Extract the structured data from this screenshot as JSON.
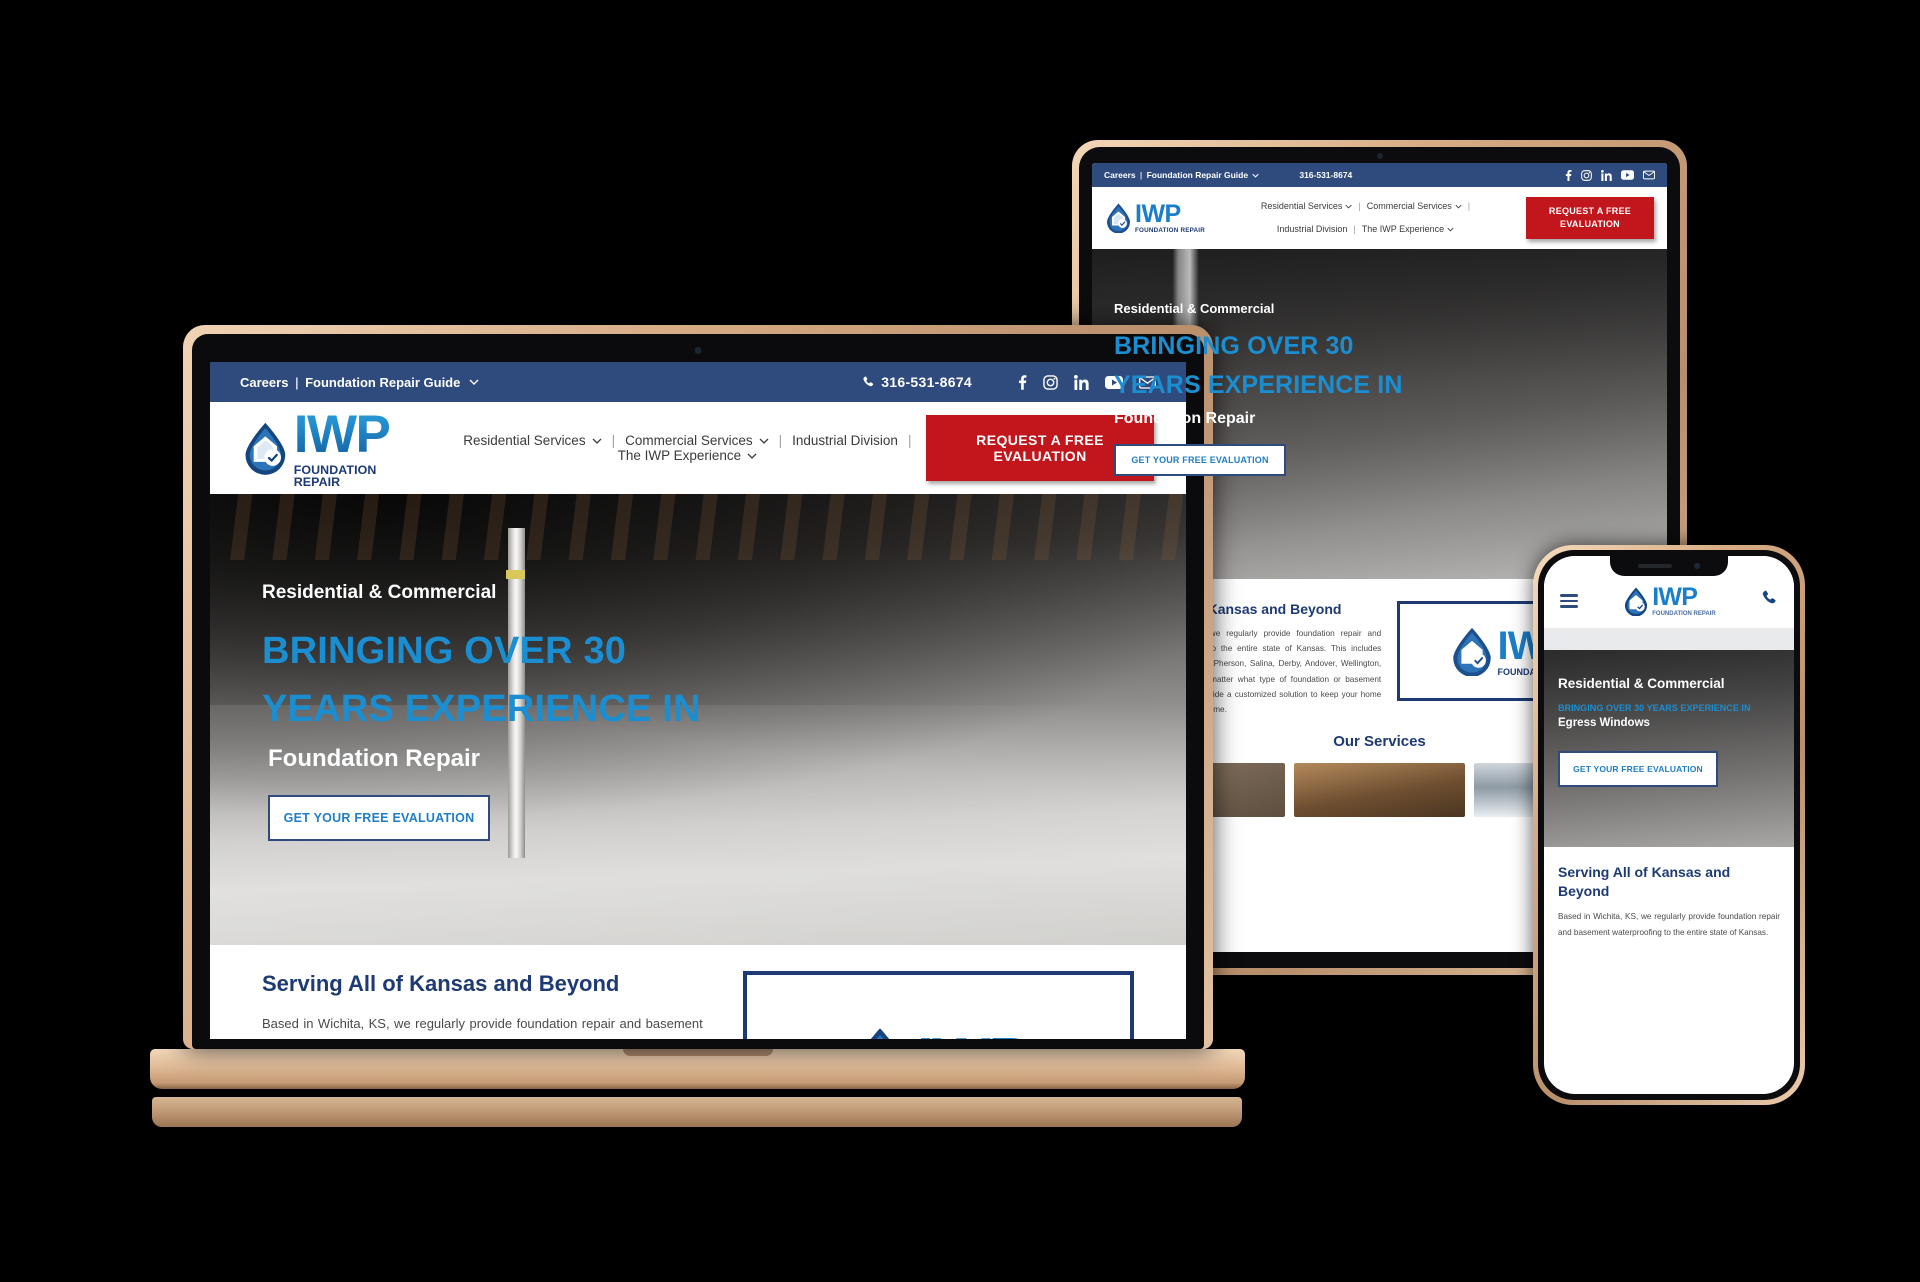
{
  "brand": {
    "name": "IWP",
    "tagline": "FOUNDATION REPAIR",
    "accent_blue": "#1b8ed1",
    "navy": "#1d3a73",
    "topbar_blue": "#2f4a7c",
    "cta_red": "#c1161c"
  },
  "topbar": {
    "careers_label": "Careers",
    "separator": "|",
    "guide_label": "Foundation Repair Guide",
    "guide_caret": "chevron-down-icon",
    "phone": "316-531-8674",
    "phone_icon": "phone-icon",
    "social": [
      {
        "name": "facebook-icon",
        "label": "f"
      },
      {
        "name": "instagram-icon",
        "label": "Instagram"
      },
      {
        "name": "linkedin-icon",
        "label": "in"
      },
      {
        "name": "youtube-icon",
        "label": "YouTube"
      },
      {
        "name": "email-icon",
        "label": "Email"
      }
    ]
  },
  "nav": {
    "items": [
      {
        "label": "Residential Services",
        "has_caret": true
      },
      {
        "label": "Commercial Services",
        "has_caret": true
      },
      {
        "label": "Industrial Division",
        "has_caret": false
      },
      {
        "label": "The IWP Experience",
        "has_caret": true
      }
    ],
    "separator": "|",
    "cta_label": "REQUEST A FREE EVALUATION",
    "cta_label_line1": "REQUEST A FREE",
    "cta_label_line2": "EVALUATION"
  },
  "hero": {
    "eyebrow": "Residential & Commercial",
    "headline_line1": "BRINGING OVER 30",
    "headline_line2": "YEARS EXPERIENCE IN",
    "subject": "Foundation Repair",
    "button_label": "GET YOUR FREE EVALUATION"
  },
  "hero_phone": {
    "eyebrow": "Residential & Commercial",
    "headline": "BRINGING OVER 30 YEARS EXPERIENCE IN",
    "subject": "Egress Windows",
    "button_label": "GET YOUR FREE EVALUATION"
  },
  "serving": {
    "heading": "Serving All of Kansas and Beyond",
    "heading_line1": "Serving All of Kansas and",
    "heading_line2": "Beyond",
    "body": "Based in Wichita, KS, we regularly provide foundation repair and basement waterproofing to the entire state of Kansas. This includes Valley Center, Newton, McPherson, Salina, Derby, Andover, Wellington, Hugoton, and more. No matter what type of foundation or basement you're having, we will provide a customized solution to keep your home safe and dry for years to come.",
    "body_short": "Based in Wichita, KS, we regularly provide foundation repair and basement waterproofing to the entire state of Kansas."
  },
  "services": {
    "heading": "Our Services"
  },
  "devices": [
    {
      "name": "laptop",
      "label": "laptop-device"
    },
    {
      "name": "tablet",
      "label": "tablet-device"
    },
    {
      "name": "phone",
      "label": "phone-device"
    }
  ]
}
